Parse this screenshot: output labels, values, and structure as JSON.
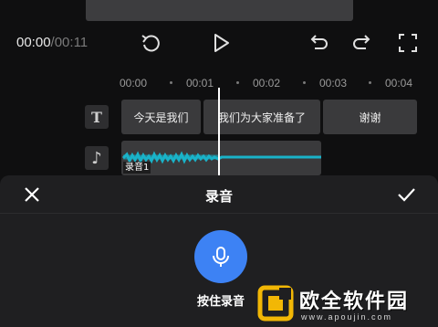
{
  "playback": {
    "current": "00:00",
    "total": "/00:11"
  },
  "toolbar": {
    "replay_icon": "replay-icon",
    "play_icon": "play-icon",
    "undo_icon": "undo-icon",
    "redo_icon": "redo-icon",
    "fullscreen_icon": "fullscreen-icon"
  },
  "ruler": {
    "ticks": [
      "00:00",
      "00:01",
      "00:02",
      "00:03",
      "00:04"
    ]
  },
  "tracks": {
    "text_icon": "T",
    "music_icon": "♪",
    "text_clips": [
      "今天是我们",
      "我们为大家准备了",
      "谢谢"
    ],
    "audio_clip_label": "录音1"
  },
  "record_panel": {
    "title": "录音",
    "hold_to_record_label": "按住录音"
  },
  "watermark": {
    "name": "欧全软件园",
    "url": "www.apoujin.com"
  },
  "colors": {
    "accent_blue": "#3d82f4",
    "waveform": "#19b3c9",
    "watermark_gold": "#f2b705"
  }
}
